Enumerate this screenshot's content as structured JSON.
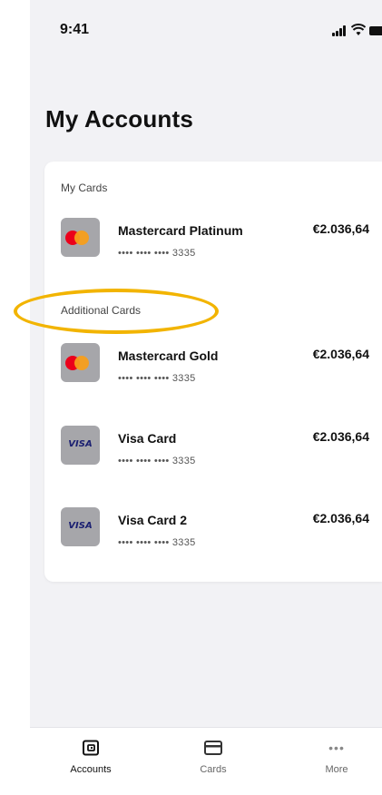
{
  "status_bar": {
    "time": "9:41"
  },
  "page": {
    "title": "My Accounts"
  },
  "sections": {
    "my_cards": "My Cards",
    "additional_cards": "Additional Cards"
  },
  "cards": [
    {
      "name": "Mastercard Platinum",
      "number": "•••• •••• •••• 3335",
      "balance": "€2.036,64",
      "brand": "mastercard"
    },
    {
      "name": "Mastercard Gold",
      "number": "•••• •••• •••• 3335",
      "balance": "€2.036,64",
      "brand": "mastercard"
    },
    {
      "name": "Visa Card",
      "number": "•••• •••• •••• 3335",
      "balance": "€2.036,64",
      "brand": "visa",
      "logo_text": "VISA"
    },
    {
      "name": "Visa Card 2",
      "number": "•••• •••• •••• 3335",
      "balance": "€2.036,64",
      "brand": "visa",
      "logo_text": "VISA"
    }
  ],
  "tabs": [
    {
      "label": "Accounts",
      "icon": "wallet-icon",
      "active": true
    },
    {
      "label": "Cards",
      "icon": "credit-card-icon",
      "active": false
    },
    {
      "label": "More",
      "icon": "more-dots-icon",
      "active": false
    }
  ],
  "colors": {
    "background": "#f2f2f5",
    "highlight": "#f2b400",
    "mastercard_red": "#eb001b",
    "mastercard_orange": "#f79e1b",
    "visa_blue": "#1a1f71"
  }
}
